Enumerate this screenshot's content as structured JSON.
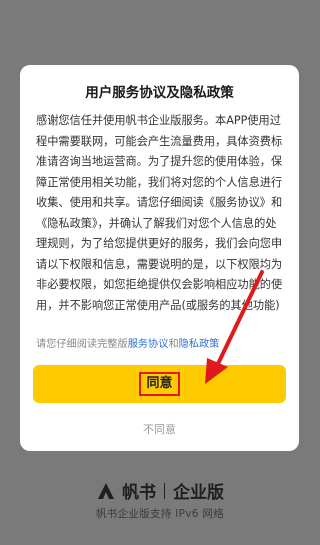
{
  "dialog": {
    "title": "用户服务协议及隐私政策",
    "body_text": "感谢您信任并使用帆书企业版服务。本APP使用过程中需要联网，可能会产生流量费用，具体资费标准请咨询当地运营商。为了提升您的使用体验，保障正常使用相关功能，我们将对您的个人信息进行收集、使用和共享。请您仔细阅读《服务协议》和《隐私政策》，并确认了解我们对您个人信息的处理规则，为了给您提供更好的服务，我们会向您申请以下权限和信息，需要说明的是，以下权限均为非必要权限，如您拒绝提供仅会影响相应功能的使用，并不影响您正常使用产品(或服务的其他功能)",
    "hint_prefix": "请您仔细阅读完整版",
    "hint_link_service": "服务协议",
    "hint_and": "和",
    "hint_link_privacy": "隐私政策",
    "agree_label": "同意",
    "disagree_label": "不同意"
  },
  "background": {
    "brand_name": "帆书",
    "brand_edition": "企业版",
    "brand_subtitle": "帆书企业版支持 IPv6 网络"
  },
  "colors": {
    "accent_button": "#ffcb00",
    "link": "#2f6fd6",
    "annotation": "#e01a1a",
    "overlay": "#7a7a7a"
  },
  "icons": {
    "logo": "fanshu-logo-icon",
    "annotation": "red-arrow-annotation"
  }
}
